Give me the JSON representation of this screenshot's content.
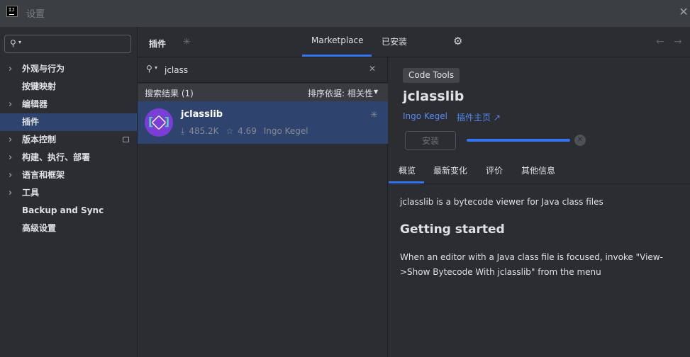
{
  "window": {
    "title": "设置",
    "logo_text": "IJ"
  },
  "sidebar": {
    "search_placeholder": "",
    "items": [
      {
        "label": "外观与行为",
        "expandable": true
      },
      {
        "label": "按键映射",
        "expandable": false
      },
      {
        "label": "编辑器",
        "expandable": true
      },
      {
        "label": "插件",
        "expandable": false,
        "selected": true
      },
      {
        "label": "版本控制",
        "expandable": true
      },
      {
        "label": "构建、执行、部署",
        "expandable": true
      },
      {
        "label": "语言和框架",
        "expandable": true
      },
      {
        "label": "工具",
        "expandable": true
      },
      {
        "label": "Backup and Sync",
        "expandable": false
      },
      {
        "label": "高级设置",
        "expandable": false
      }
    ]
  },
  "header": {
    "title": "插件",
    "tabs": [
      {
        "label": "Marketplace",
        "active": true
      },
      {
        "label": "已安装",
        "active": false
      }
    ]
  },
  "plugin_list": {
    "search_value": "jclass",
    "results_label": "搜索结果 (1)",
    "sort_label": "排序依据: 相关性",
    "items": [
      {
        "name": "jclasslib",
        "downloads": "485.2K",
        "rating": "4.69",
        "vendor": "Ingo Kegel"
      }
    ]
  },
  "detail": {
    "category": "Code Tools",
    "name": "jclasslib",
    "vendor": "Ingo Kegel",
    "homepage_label": "插件主页",
    "install_label": "安装",
    "install_progress": 1.0,
    "tabs": [
      "概览",
      "最新变化",
      "评价",
      "其他信息"
    ],
    "description": "jclasslib is a bytecode viewer for Java class files",
    "heading": "Getting started",
    "body": "When an editor with a Java class file is focused, invoke \"View->Show Bytecode With jclasslib\" from the menu"
  },
  "colors": {
    "accent": "#3574f0",
    "selection": "#2e436e",
    "link": "#548af7"
  }
}
